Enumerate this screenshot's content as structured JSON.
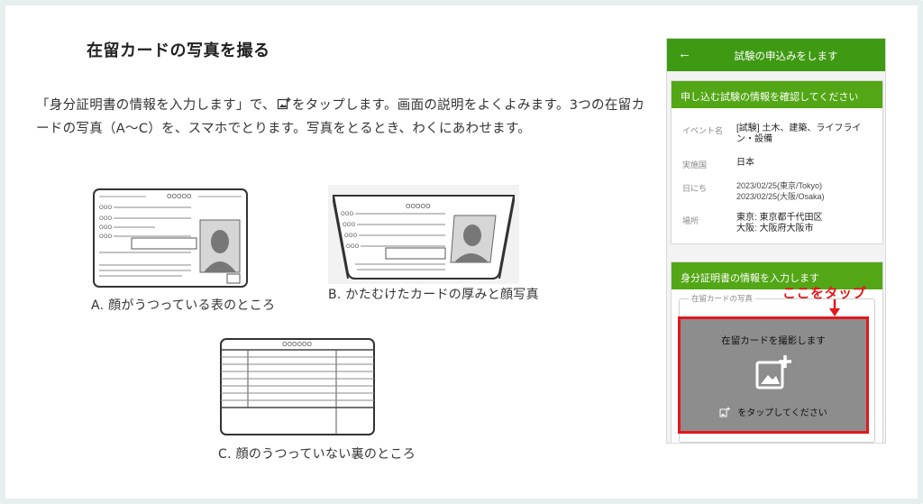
{
  "heading": "在留カードの写真を撮る",
  "instructions": {
    "before_icon": "「身分証明書の情報を入力します」で、",
    "after_icon": "をタップします。画面の説明をよくよみます。3つの在留カードの写真（A〜C）を、スマホでとります。写真をとるとき、わくにあわせます。"
  },
  "figures": [
    {
      "caption": "A. 顔がうつっている表のところ",
      "icon": "card-front-illustration",
      "code": "OOOOO",
      "row_labels": [
        "OOO",
        "OOO",
        "OOO",
        "OOO"
      ]
    },
    {
      "caption": "B. かたむけたカードの厚みと顔写真",
      "icon": "card-tilted-illustration",
      "code": "OOOOO",
      "row_labels": [
        "OOO",
        "OOO",
        "OOO",
        "OOO"
      ]
    },
    {
      "caption": "C. 顔のうつっていない裏のところ",
      "icon": "card-back-illustration",
      "code": "OOOOOO"
    }
  ],
  "phone": {
    "back_icon": "←",
    "title": "試験の申込みをします",
    "confirm_panel": {
      "header": "申し込む試験の情報を確認してください",
      "rows": [
        {
          "label": "イベント名",
          "value": "[試験] 土木、建築、ライフライン・設備"
        },
        {
          "label": "実施国",
          "value": "日本"
        },
        {
          "label": "日にち",
          "value": "2023/02/25(東京/Tokyo)\n2023/02/25(大阪/Osaka)"
        },
        {
          "label": "場所",
          "value": "東京: 東京都千代田区\n大阪: 大阪府大阪市"
        }
      ]
    },
    "id_panel": {
      "header": "身分証明書の情報を入力します",
      "legend": "在留カードの写真",
      "shoot_title": "在留カードを撮影します",
      "tap_text": "をタップしてください",
      "icon": "add-photo-icon"
    }
  },
  "annotation": "ここをタップ",
  "colors": {
    "green_bar": "#3f9a13",
    "green_header": "#53a716",
    "highlight": "#e3171d",
    "shoot_bg": "#8d8d8d"
  }
}
